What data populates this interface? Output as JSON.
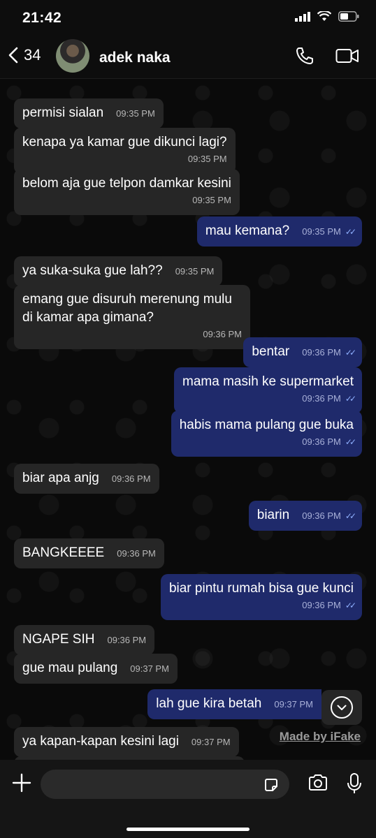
{
  "status_bar": {
    "time": "21:42"
  },
  "header": {
    "back_count": "34",
    "contact_name": "adek naka"
  },
  "messages": [
    {
      "dir": "in",
      "text": "permisi sialan",
      "time": "09:35 PM"
    },
    {
      "dir": "in",
      "text": "kenapa ya kamar gue dikunci lagi?",
      "time": "09:35 PM"
    },
    {
      "dir": "in",
      "text": "belom aja gue telpon damkar kesini",
      "time": "09:35 PM"
    },
    {
      "dir": "out",
      "text": "mau kemana?",
      "time": "09:35 PM"
    },
    {
      "dir": "in",
      "text": "ya suka-suka gue lah??",
      "time": "09:35 PM"
    },
    {
      "dir": "in",
      "text": "emang gue disuruh merenung mulu di kamar apa gimana?",
      "time": "09:36 PM"
    },
    {
      "dir": "out",
      "text": "bentar",
      "time": "09:36 PM"
    },
    {
      "dir": "out",
      "text": "mama masih ke supermarket",
      "time": "09:36 PM"
    },
    {
      "dir": "out",
      "text": "habis mama pulang gue buka",
      "time": "09:36 PM"
    },
    {
      "dir": "in",
      "text": "biar apa anjg",
      "time": "09:36 PM"
    },
    {
      "dir": "out",
      "text": "biarin",
      "time": "09:36 PM"
    },
    {
      "dir": "in",
      "text": "BANGKEEEE",
      "time": "09:36 PM"
    },
    {
      "dir": "out",
      "text": "biar pintu rumah bisa gue kunci",
      "time": "09:36 PM"
    },
    {
      "dir": "in",
      "text": "NGAPE SIH",
      "time": "09:36 PM"
    },
    {
      "dir": "in",
      "text": "gue mau pulang",
      "time": "09:37 PM"
    },
    {
      "dir": "out",
      "text": "lah gue kira betah",
      "time": "09:37 PM"
    },
    {
      "dir": "in",
      "text": "ya kapan-kapan kesini lagi",
      "time": "09:37 PM"
    }
  ],
  "watermark": "Made by iFake",
  "colors": {
    "incoming_bubble": "#262626",
    "outgoing_bubble": "#1f2a6b",
    "read_ticks": "#8fb0ff"
  }
}
